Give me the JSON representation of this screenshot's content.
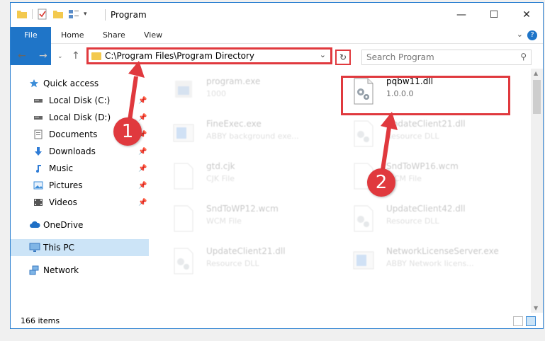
{
  "window": {
    "title": "Program",
    "controls": {
      "minimize": "—",
      "maximize": "☐",
      "close": "✕"
    }
  },
  "ribbon": {
    "tabs": [
      "File",
      "Home",
      "Share",
      "View"
    ],
    "help": "?"
  },
  "address": {
    "path": "C:\\Program Files\\Program Directory",
    "search_placeholder": "Search Program"
  },
  "nav": {
    "items": [
      {
        "label": "Quick access",
        "icon": "star-icon",
        "pinned": false
      },
      {
        "label": "Local Disk (C:)",
        "icon": "drive-icon",
        "pinned": true
      },
      {
        "label": "Local Disk (D:)",
        "icon": "drive-icon",
        "pinned": true
      },
      {
        "label": "Documents",
        "icon": "documents-icon",
        "pinned": true
      },
      {
        "label": "Downloads",
        "icon": "download-arrow-icon",
        "pinned": true
      },
      {
        "label": "Music",
        "icon": "music-note-icon",
        "pinned": true
      },
      {
        "label": "Pictures",
        "icon": "pictures-icon",
        "pinned": true
      },
      {
        "label": "Videos",
        "icon": "videos-icon",
        "pinned": true
      },
      {
        "label": "OneDrive",
        "icon": "cloud-icon",
        "pinned": false
      },
      {
        "label": "This PC",
        "icon": "monitor-icon",
        "pinned": false,
        "selected": true
      },
      {
        "label": "Network",
        "icon": "network-icon",
        "pinned": false
      }
    ]
  },
  "files": [
    {
      "name": "program.exe",
      "sub": "1000",
      "icon": "exe-icon",
      "faded": true
    },
    {
      "name": "pqbw11.dll",
      "sub": "1.0.0.0",
      "icon": "dll-gear-icon",
      "faded": false
    },
    {
      "name": "FineExec.exe",
      "sub": "ABBY background exe...",
      "icon": "app-window-icon",
      "faded": true
    },
    {
      "name": "UpdateClient21.dll",
      "sub": "Resource DLL",
      "icon": "dll-gear-icon",
      "faded": true
    },
    {
      "name": "gtd.cjk",
      "sub": "CJK File",
      "icon": "blank-file-icon",
      "faded": true
    },
    {
      "name": "SndToWP16.wcm",
      "sub": "WCM File",
      "icon": "blank-file-icon",
      "faded": true
    },
    {
      "name": "SndToWP12.wcm",
      "sub": "WCM File",
      "icon": "blank-file-icon",
      "faded": true
    },
    {
      "name": "UpdateClient42.dll",
      "sub": "Resource DLL",
      "icon": "dll-gear-icon",
      "faded": true
    },
    {
      "name": "UpdateClient21.dll",
      "sub": "Resource DLL",
      "icon": "dll-gear-icon",
      "faded": true
    },
    {
      "name": "NetworkLicenseServer.exe",
      "sub": "ABBY Network licens...",
      "icon": "app-window-icon",
      "faded": true
    }
  ],
  "status": {
    "count": "166 items"
  },
  "annotations": {
    "badge1": "1",
    "badge2": "2"
  },
  "colors": {
    "accent": "#1f75c8",
    "highlight": "#e0393e",
    "selected": "#cce4f7"
  }
}
